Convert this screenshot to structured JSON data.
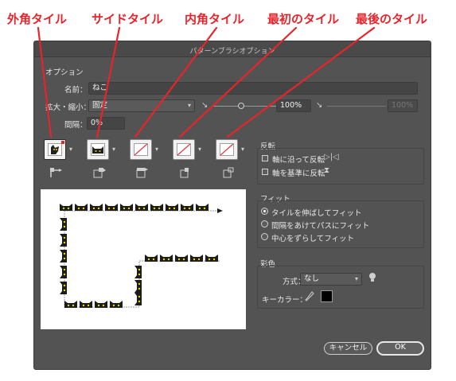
{
  "annotations": [
    {
      "label": "外角タイル"
    },
    {
      "label": "サイドタイル"
    },
    {
      "label": "内角タイル"
    },
    {
      "label": "最初のタイル"
    },
    {
      "label": "最後のタイル"
    }
  ],
  "dialog": {
    "title": "パターンブラシオプション",
    "options_header": "オプション",
    "name": {
      "label": "名前：",
      "value": "ねこ"
    },
    "scale": {
      "label": "拡大・縮小：",
      "mode": "固定",
      "percent": "100%",
      "max_percent": "100%"
    },
    "spacing": {
      "label": "間隔：",
      "value": "0%"
    },
    "flip": {
      "title": "反転",
      "along": "軸に沿って反転",
      "across": "軸を基準に反転"
    },
    "fit": {
      "title": "フィット",
      "options": [
        "タイルを伸ばしてフィット",
        "間隔をあけてパスにフィット",
        "中心をずらしてフィット"
      ],
      "selected_index": 0
    },
    "colorization": {
      "title": "彩色",
      "method_label": "方式：",
      "method_value": "なし",
      "key_color_label": "キーカラー：",
      "key_color": "#000000"
    },
    "buttons": {
      "cancel": "キャンセル",
      "ok": "OK"
    }
  },
  "colors": {
    "annotation": "#e8242b",
    "dialog_bg": "#535353",
    "none_slash": "#e8242b"
  }
}
